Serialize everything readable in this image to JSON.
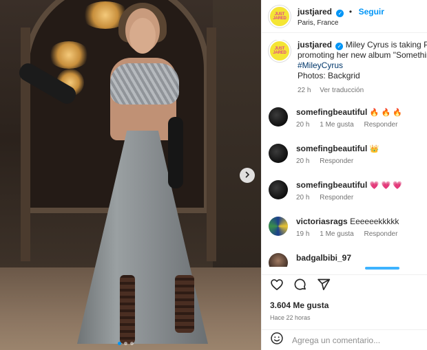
{
  "post": {
    "username": "justjared",
    "follow_label": "Seguir",
    "separator": "•",
    "location": "Paris, France",
    "avatar_text": "JUST JARED"
  },
  "caption": {
    "username": "justjared",
    "line1": "Miley Cyrus is taking Paris",
    "line2": "promoting her new album \"Something",
    "hashtag": "#MileyCyrus",
    "line3": "Photos: Backgrid",
    "time": "22 h",
    "translate": "Ver traducción"
  },
  "comments": [
    {
      "user": "somefingbeautiful",
      "emoji": "🔥 🔥 🔥",
      "time": "20 h",
      "likes": "1 Me gusta",
      "reply": "Responder"
    },
    {
      "user": "somefingbeautiful",
      "emoji": "👑",
      "time": "20 h",
      "reply": "Responder"
    },
    {
      "user": "somefingbeautiful",
      "emoji": "💗 💗 💗",
      "time": "20 h",
      "reply": "Responder"
    },
    {
      "user": "victoriasrags",
      "text": "Eeeeeekkkkk",
      "time": "19 h",
      "likes": "1 Me gusta",
      "reply": "Responder"
    },
    {
      "user": "badgalbibi_97"
    }
  ],
  "actions": {
    "likes": "3.604 Me gusta",
    "ago": "Hace 22 horas",
    "comment_placeholder": "Agrega un comentario..."
  },
  "carousel": {
    "current": 1,
    "total": 3
  },
  "colors": {
    "accent": "#0095f6",
    "verified": "#0095f6",
    "brand_yellow": "#f4e534",
    "brand_pink": "#e0468a"
  }
}
